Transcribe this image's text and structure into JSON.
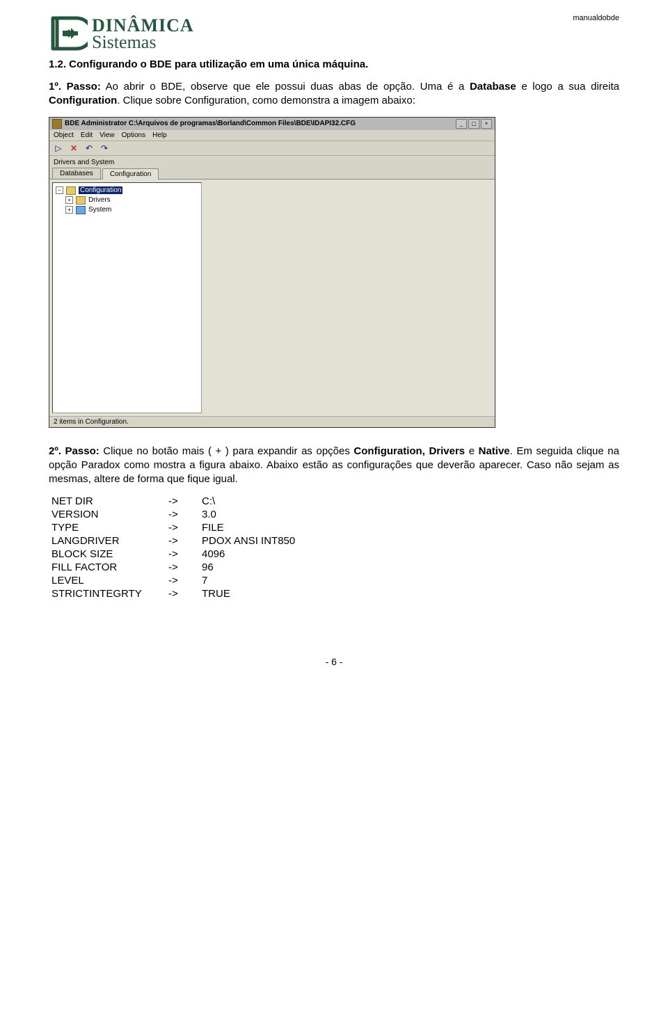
{
  "doc_tag": "manualdobde",
  "logo": {
    "line1": "DINÂMICA",
    "line2": "Sistemas"
  },
  "section_title": "1.2. Configurando o BDE para utilização em uma única máquina.",
  "para1_lead": "1º. Passo:",
  "para1_a": " Ao abrir o BDE, observe que ele possui duas abas de opção. Uma é a ",
  "para1_b": "Database",
  "para1_c": " e logo a sua direita ",
  "para1_d": "Configuration",
  "para1_e": ". Clique sobre Configuration, como demonstra a imagem abaixo:",
  "screenshot": {
    "title": "BDE Administrator  C:\\Arquivos de programas\\Borland\\Common Files\\BDE\\IDAPI32.CFG",
    "menus": [
      "Object",
      "Edit",
      "View",
      "Options",
      "Help"
    ],
    "upper_label": "Drivers and System",
    "tabs": [
      "Databases",
      "Configuration"
    ],
    "active_tab": 1,
    "tree": {
      "root": "Configuration",
      "children": [
        "Drivers",
        "System"
      ]
    },
    "status": "2 items in Configuration."
  },
  "para2_lead": "2º. Passo:",
  "para2_a": " Clique no botão mais ( + ) para expandir as opções ",
  "para2_b": "Configuration, Drivers",
  "para2_c": " e ",
  "para2_d": "Native",
  "para2_e": ". Em seguida clique na opção Paradox como mostra a figura abaixo. Abaixo estão as configurações que deverão aparecer. Caso não sejam as mesmas, altere de forma que fique igual.",
  "settings": [
    {
      "k": "NET DIR",
      "v": "C:\\"
    },
    {
      "k": "VERSION",
      "v": "3.0"
    },
    {
      "k": "TYPE",
      "v": "FILE"
    },
    {
      "k": "LANGDRIVER",
      "v": "PDOX ANSI INT850"
    },
    {
      "k": "BLOCK SIZE",
      "v": "4096"
    },
    {
      "k": "FILL FACTOR",
      "v": "96"
    },
    {
      "k": "LEVEL",
      "v": "7"
    },
    {
      "k": "STRICTINTEGRTY",
      "v": "TRUE"
    }
  ],
  "arrow": "->",
  "page_num": "- 6 -"
}
